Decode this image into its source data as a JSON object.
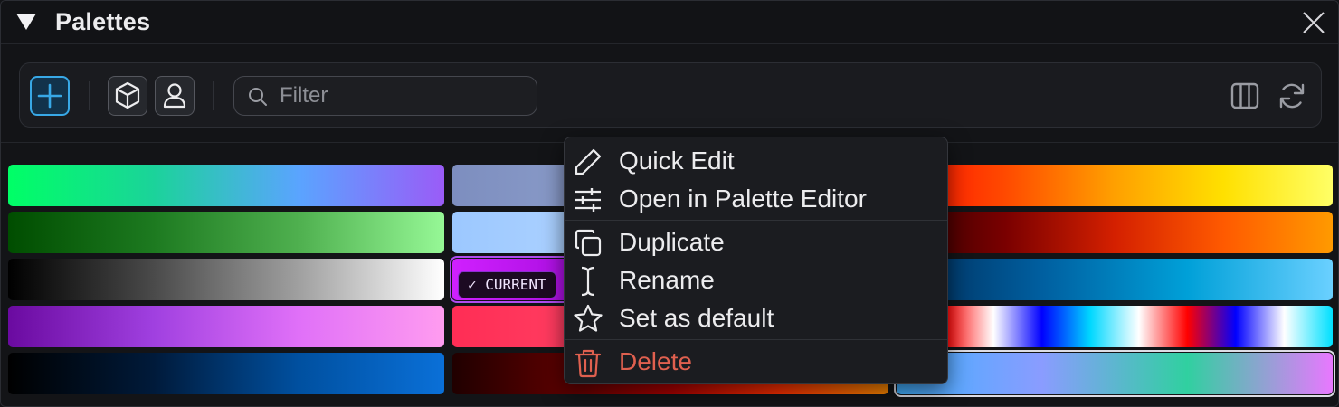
{
  "panel": {
    "title": "Palettes"
  },
  "toolbar": {
    "add_icon": "plus-icon",
    "builtin_icon": "cube-icon",
    "user_icon": "user-icon",
    "search_placeholder": "Filter",
    "search_value": "",
    "columns_icon": "columns-icon",
    "refresh_icon": "refresh-icon",
    "accent": "#38a8e6"
  },
  "swatches": [
    {
      "colors": [
        "#00ff66",
        "#1bd39a",
        "#5aa4ff",
        "#9a5cf7"
      ]
    },
    {
      "colors": [
        "#7d8ebf",
        "#92a4cf",
        "#b4b0e5"
      ]
    },
    {
      "colors": [
        "#ff0a00",
        "#ff4a00",
        "#ffa000",
        "#ffe000",
        "#ffff66"
      ]
    },
    {
      "colors": [
        "#004d00",
        "#1d7a20",
        "#4fb04f",
        "#96f896"
      ]
    },
    {
      "colors": [
        "#9cc8ff",
        "#b8d8ff",
        "#d6e8ff"
      ]
    },
    {
      "colors": [
        "#2c0000",
        "#7a0000",
        "#d42000",
        "#ff5a00",
        "#ff9a00"
      ]
    },
    {
      "colors": [
        "#000000",
        "#4a4a4a",
        "#a0a0a0",
        "#ffffff"
      ]
    },
    {
      "colors": [
        "#d020ff",
        "#8c00c8",
        "#5a00b0"
      ],
      "badge": "✓ CURRENT"
    },
    {
      "colors": [
        "#002a55",
        "#005fa0",
        "#00a0d8",
        "#6ad0ff"
      ]
    },
    {
      "colors": [
        "#6a0aa0",
        "#a040e0",
        "#e070f8",
        "#ff9cf0"
      ]
    },
    {
      "colors": [
        "#ff2d55",
        "#ff4a6a",
        "#ff7090"
      ]
    },
    {
      "colors": [
        "#000000",
        "#ff0000",
        "#ffffff",
        "#0000ff",
        "#00d8ff",
        "#ffffff",
        "#ff0000",
        "#0000ff",
        "#ffffff",
        "#00e0ff"
      ]
    },
    {
      "colors": [
        "#000000",
        "#001a3a",
        "#0050a0",
        "#0a70d8"
      ]
    },
    {
      "colors": [
        "#200000",
        "#5a0000",
        "#b00000",
        "#ff3000",
        "#ff8a00"
      ]
    },
    {
      "colors": [
        "#40b0ff",
        "#8a9cff",
        "#30d0a0",
        "#e878ff"
      ],
      "selected": true
    }
  ],
  "context_menu": {
    "items": [
      {
        "label": "Quick Edit",
        "icon": "pencil-icon"
      },
      {
        "label": "Open in Palette Editor",
        "icon": "sliders-icon"
      },
      {
        "label": "Duplicate",
        "icon": "duplicate-icon"
      },
      {
        "label": "Rename",
        "icon": "text-cursor-icon"
      },
      {
        "label": "Set as default",
        "icon": "star-icon"
      },
      {
        "label": "Delete",
        "icon": "trash-icon",
        "danger": true,
        "color": "#e0604f"
      }
    ]
  }
}
